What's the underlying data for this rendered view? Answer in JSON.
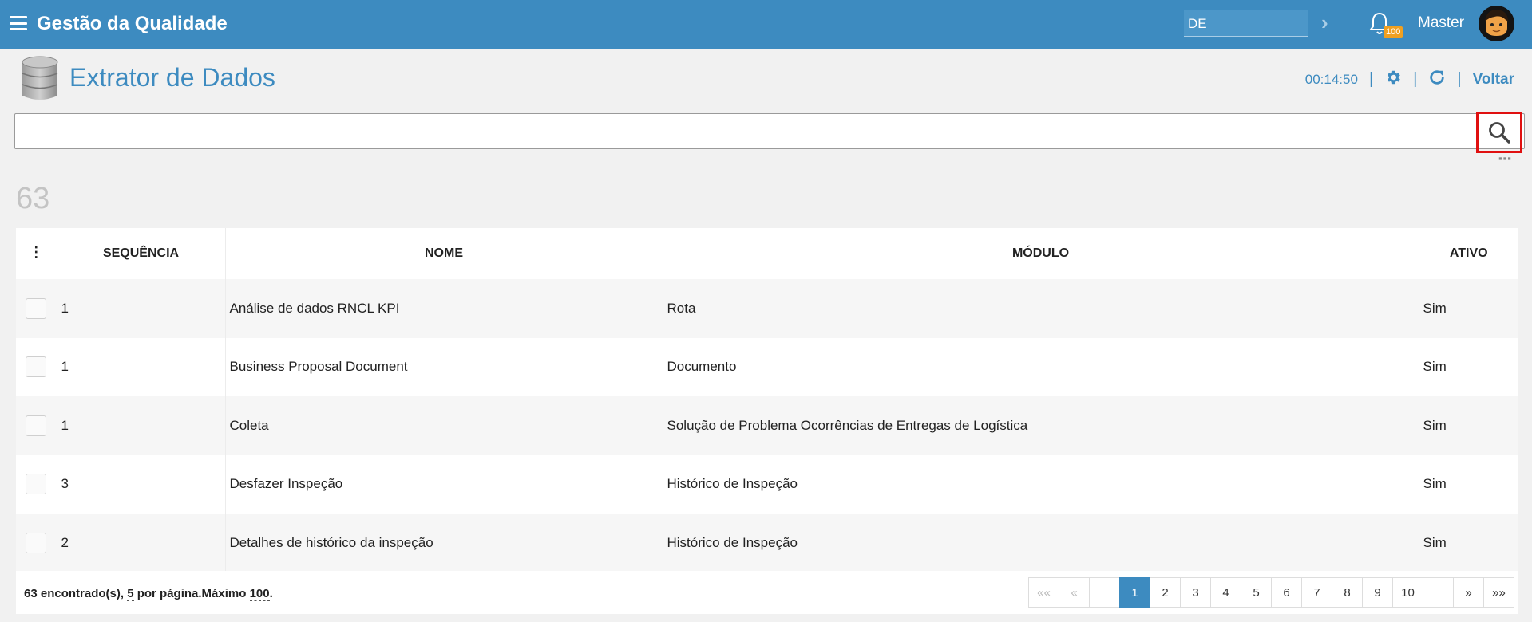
{
  "topbar": {
    "title": "Gestão da Qualidade",
    "language": "DE",
    "notification_count": "100",
    "user": "Master"
  },
  "page": {
    "title": "Extrator de Dados",
    "timer": "00:14:50",
    "back_label": "Voltar"
  },
  "search": {
    "value": "",
    "placeholder": ""
  },
  "result_count": "63",
  "table": {
    "columns": {
      "sequence": "SEQUÊNCIA",
      "name": "NOME",
      "module": "MÓDULO",
      "active": "ATIVO"
    },
    "rows": [
      {
        "seq": "1",
        "name": "Análise de dados RNCL KPI",
        "module": "Rota",
        "active": "Sim"
      },
      {
        "seq": "1",
        "name": "Business Proposal Document",
        "module": "Documento",
        "active": "Sim"
      },
      {
        "seq": "1",
        "name": "Coleta",
        "module": "Solução de Problema Ocorrências de Entregas de Logística",
        "active": "Sim"
      },
      {
        "seq": "3",
        "name": "Desfazer Inspeção",
        "module": "Histórico de Inspeção",
        "active": "Sim"
      },
      {
        "seq": "2",
        "name": "Detalhes de histórico da inspeção",
        "module": "Histórico de Inspeção",
        "active": "Sim"
      }
    ]
  },
  "footer": {
    "found": "63 encontrado(s),",
    "per_page_num": "5",
    "per_page_text": "por página.Máximo",
    "max": "100",
    "period": "."
  },
  "pagination": {
    "first": "««",
    "prev": "«",
    "pages": [
      "1",
      "2",
      "3",
      "4",
      "5",
      "6",
      "7",
      "8",
      "9",
      "10"
    ],
    "current": "1",
    "next": "»",
    "last": "»»"
  },
  "colors": {
    "primary": "#3d8bc0",
    "badge": "#f0a020",
    "highlight": "#e01010"
  }
}
